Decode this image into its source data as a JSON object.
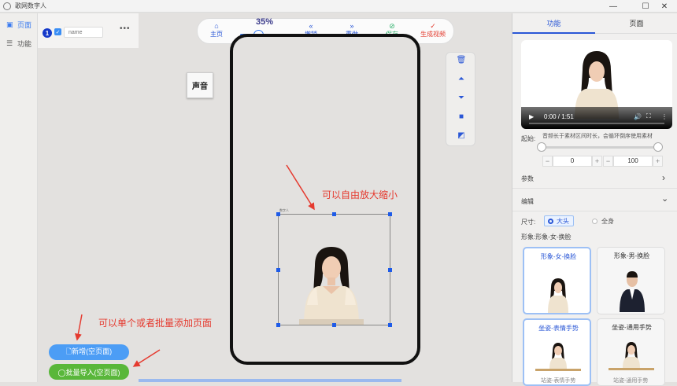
{
  "window": {
    "title": "歌网数字人",
    "minimize": "—",
    "maximize": "☐",
    "close": "✕"
  },
  "leftnav": [
    {
      "icon": "page-icon",
      "glyph": "▣",
      "label": "页面"
    },
    {
      "icon": "sliders-icon",
      "glyph": "☰",
      "label": "功能"
    }
  ],
  "pagelist": {
    "number": "1",
    "name_placeholder": "name",
    "more": "•••"
  },
  "toolbar": {
    "home": {
      "icon": "⌂",
      "label": "主页"
    },
    "zoom_percent": "35%",
    "zoom_value": 0.35,
    "undo": {
      "icon": "«",
      "label": "撤销"
    },
    "redo": {
      "icon": "»",
      "label": "重做"
    },
    "save": {
      "icon": "⊘",
      "label": "保存"
    },
    "generate": {
      "icon": "✓",
      "label": "生成视频"
    }
  },
  "sidetools": {
    "delete": "🗑",
    "move_up": "⏶",
    "move_down": "⏷",
    "bring_front": "■",
    "send_back": "◩"
  },
  "canvas": {
    "sound_button": "声音",
    "element_tag": "数字人"
  },
  "annotations": {
    "resize_hint": "可以自由放大缩小",
    "add_hint": "可以单个或者批量添加页面"
  },
  "buttons": {
    "add_page": "🗋新增(空页面)",
    "batch_import": "◯批量导入(空页面)"
  },
  "rightpanel": {
    "tabs": [
      "功能",
      "页面"
    ],
    "video": {
      "time": "0:00 / 1:51",
      "play": "▶",
      "volume": "🔊",
      "fullscreen": "⛶",
      "more": "⋮"
    },
    "start_label": "起始:",
    "start_note": "音频长于素材区间时长，会循环倒序使用素材",
    "range_start": "0",
    "range_end": "100",
    "minus": "−",
    "plus": "+",
    "params_label": "参数",
    "edit_label": "编辑",
    "size_label": "尺寸:",
    "size_options": [
      "大头",
      "全身"
    ],
    "size_selected": "大头",
    "avatar_label": "形象:形象-女-换脸",
    "avatar_cards": [
      "形象-女-换脸",
      "形象-男-换脸"
    ],
    "pose_cards": [
      "坐姿-表情手势",
      "坐姿-通用手势"
    ],
    "bottom_cards": [
      "站姿-表情手势",
      "站姿-通用手势"
    ],
    "chevron_right": "›",
    "chevron_down": "⌄"
  },
  "colors": {
    "accent": "#3a7bf0",
    "add_button": "#4c9df5",
    "import_button": "#59b73a",
    "annotation": "#e53a2f",
    "generate": "#e33b2e",
    "save": "#2fb06c"
  }
}
